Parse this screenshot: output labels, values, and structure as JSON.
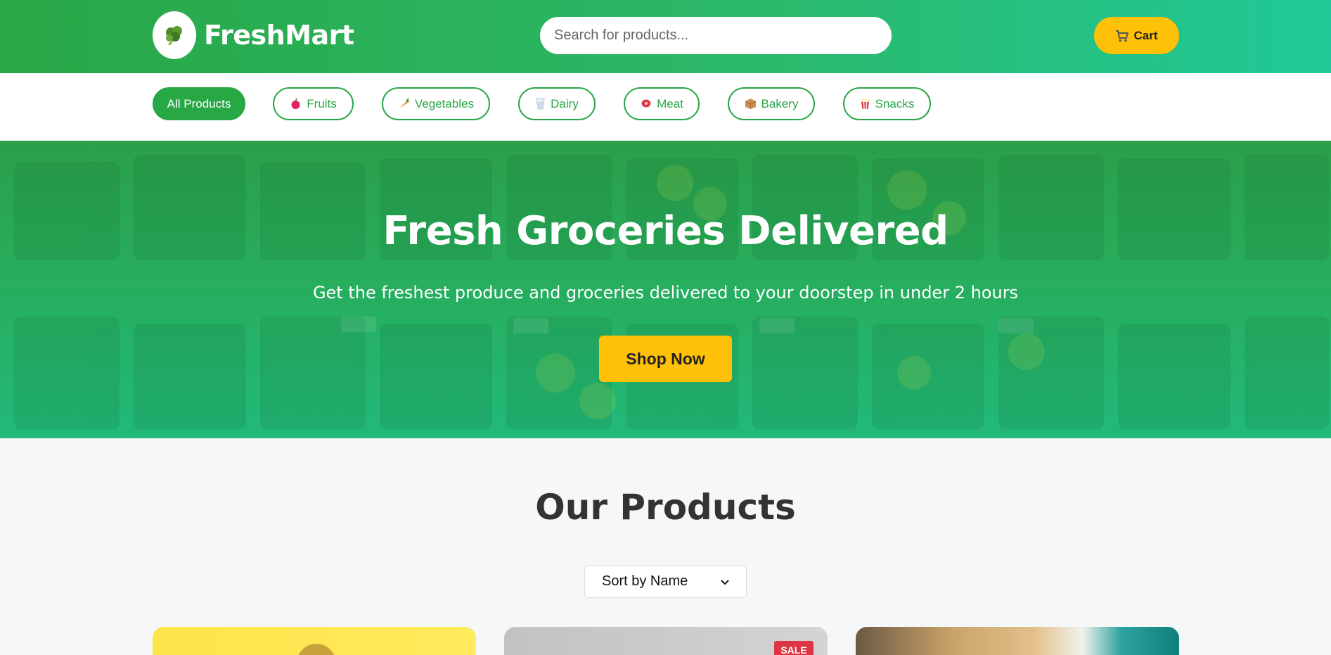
{
  "header": {
    "brand": "FreshMart",
    "logo_icon": "broccoli-icon",
    "search": {
      "placeholder": "Search for products...",
      "value": ""
    },
    "cart": {
      "label": "Cart",
      "icon": "cart-icon"
    }
  },
  "categories": [
    {
      "label": "All Products",
      "active": true
    },
    {
      "label": "Fruits",
      "icon": "apple-icon"
    },
    {
      "label": "Vegetables",
      "icon": "carrot-icon"
    },
    {
      "label": "Dairy",
      "icon": "milk-glass-icon"
    },
    {
      "label": "Meat",
      "icon": "meat-icon"
    },
    {
      "label": "Bakery",
      "icon": "box-icon"
    },
    {
      "label": "Snacks",
      "icon": "popcorn-icon"
    }
  ],
  "hero": {
    "title": "Fresh Groceries Delivered",
    "subtitle": "Get the freshest produce and groceries delivered to your doorstep in under 2 hours",
    "cta": "Shop Now"
  },
  "products": {
    "heading": "Our Products",
    "sort": {
      "selected": "Sort by Name"
    },
    "cards": [
      {
        "badge": ""
      },
      {
        "badge": "SALE"
      },
      {
        "badge": ""
      }
    ]
  },
  "colors": {
    "primary": "#28a745",
    "accent": "#ffc107",
    "sale": "#dc3545"
  }
}
